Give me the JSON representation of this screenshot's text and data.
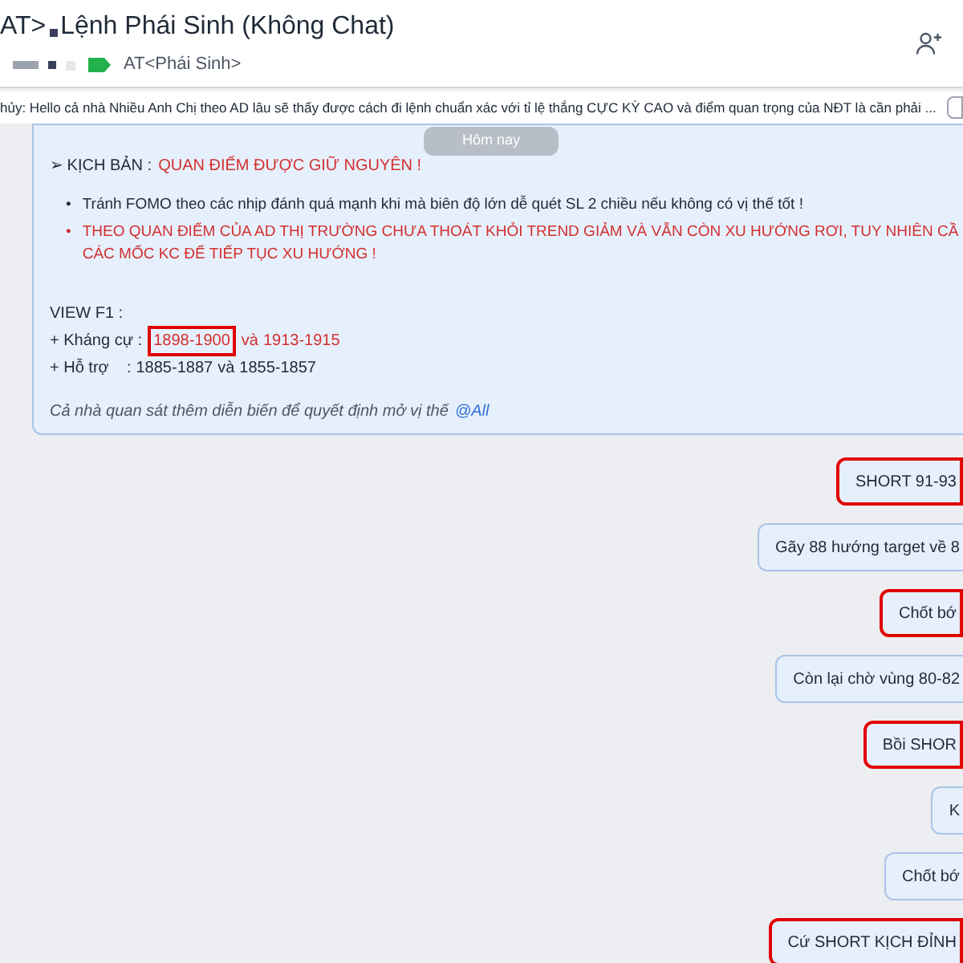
{
  "header": {
    "title_prefix": "AT>",
    "title": "Lệnh Phái Sinh (Không Chat)",
    "tag": "AT<Phái Sinh>"
  },
  "pinned": {
    "text": "hủy: Hello cả nhà Nhiều Anh Chị theo AD lâu sẽ thấy được cách đi lệnh chuẩn xác với tỉ lệ thắng CỰC KỲ CAO và điểm quan trọng của NĐT là cần phải ..."
  },
  "date_divider": "Hôm nay",
  "post": {
    "scenario_label": "➢ KỊCH BẢN :",
    "scenario_value": "QUAN ĐIỂM ĐƯỢC GIỮ NGUYÊN !",
    "bullets": [
      {
        "marker": "•",
        "lines": [
          "Tránh FOMO theo các nhịp đánh quá mạnh khi mà biên độ lớn dễ quét SL 2 chiều nếu không có vị thế tốt !"
        ],
        "emphasis": false
      },
      {
        "marker": "•",
        "lines": [
          "THEO QUAN ĐIỂM CỦA AD THỊ TRƯỜNG CHƯA THOÁT KHỎI TREND GIẢM VÀ VẪN CÒN XU HƯỚNG RƠI, TUY NHIÊN CẦ",
          "CÁC MỐC KC ĐỂ TIẾP TỤC XU HƯỚNG !"
        ],
        "emphasis": true
      }
    ],
    "view_title": "VIEW F1 :",
    "levels": [
      {
        "label": "+ Kháng cự :",
        "kind": "resistance",
        "first": "1898-1900",
        "first_boxed": true,
        "joiner": "và",
        "second": "1913-1915"
      },
      {
        "label": "+ Hỗ trợ    :",
        "kind": "support",
        "first": "1885-1887",
        "first_boxed": false,
        "joiner": "và",
        "second": "1855-1857"
      }
    ],
    "footer_text": "Cả nhà quan sát thêm diễn biến để quyết định mở vị thế",
    "mention": "@All"
  },
  "messages": [
    {
      "text": "SHORT 91-93",
      "boxed": true
    },
    {
      "text": "Gãy 88 hướng target về 8",
      "boxed": false
    },
    {
      "text": "Chốt bớ",
      "boxed": true
    },
    {
      "text": "Còn lại chờ vùng 80-82",
      "boxed": false
    },
    {
      "text": "Bồi SHOR",
      "boxed": true
    },
    {
      "text": "K",
      "boxed": false
    },
    {
      "text": "Chốt bớ",
      "boxed": false
    },
    {
      "text": "Cứ SHORT KỊCH ĐỈNH",
      "boxed": true
    }
  ]
}
